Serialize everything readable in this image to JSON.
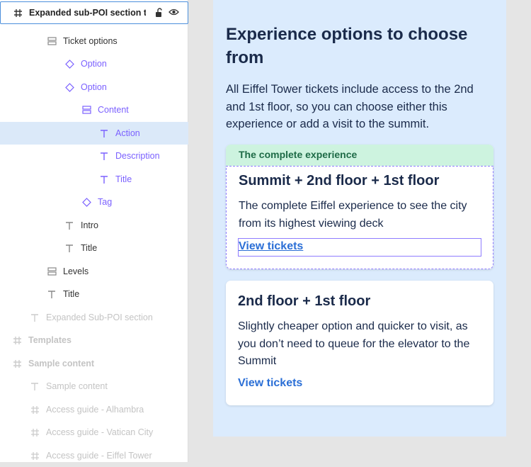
{
  "layers": {
    "frame_title": "Expanded sub-POI section t...",
    "items": [
      {
        "label": "Ticket options"
      },
      {
        "label": "Option"
      },
      {
        "label": "Option"
      },
      {
        "label": "Content"
      },
      {
        "label": "Action"
      },
      {
        "label": "Description"
      },
      {
        "label": "Title"
      },
      {
        "label": "Tag"
      },
      {
        "label": "Intro"
      },
      {
        "label": "Title"
      },
      {
        "label": "Levels"
      },
      {
        "label": "Title"
      },
      {
        "label": "Expanded Sub-POI section"
      },
      {
        "label": "Templates"
      },
      {
        "label": "Sample content"
      },
      {
        "label": "Sample content"
      },
      {
        "label": "Access guide - Alhambra"
      },
      {
        "label": "Access guide - Vatican City"
      },
      {
        "label": "Access guide - Eiffel Tower"
      }
    ]
  },
  "artboard": {
    "heading": "Experience options to choose from",
    "intro": "All Eiffel Tower tickets include access to the 2nd and 1st floor, so you can choose either this experience or add a visit to the summit.",
    "cards": [
      {
        "tag": "The complete experience",
        "title": "Summit + 2nd floor + 1st floor",
        "description": "The complete Eiffel experience to see the city from its highest viewing deck",
        "link": "View tickets"
      },
      {
        "title": "2nd floor + 1st floor",
        "description": "Slightly cheaper option and quicker to visit, as you don’t need to queue for the elevator to the Summit",
        "link": "View tickets"
      }
    ]
  }
}
